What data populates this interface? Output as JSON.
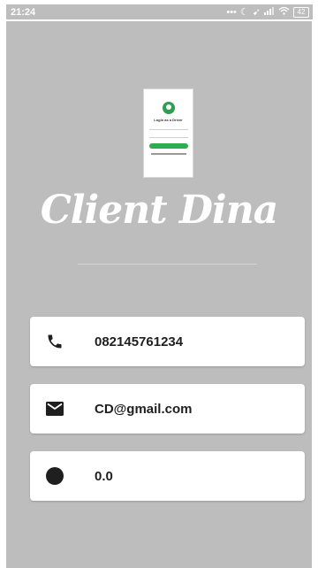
{
  "status_bar": {
    "time": "21:24",
    "icons": [
      "more-dots-icon",
      "moon-icon",
      "location-arrow-icon",
      "signal-icon",
      "wifi-icon"
    ],
    "battery": "42"
  },
  "login_preview": {
    "title": "Login as a Driver",
    "logo_icon": "map-pin-icon"
  },
  "brand": {
    "name": "Client Dina"
  },
  "profile": {
    "phone": {
      "icon": "phone-icon",
      "value": "082145761234"
    },
    "email": {
      "icon": "mail-icon",
      "value": "CD@gmail.com"
    },
    "rating": {
      "icon": "circle-icon",
      "value": "0.0"
    }
  },
  "colors": {
    "background": "#bdbdbd",
    "card": "#ffffff",
    "accent_green": "#2fae4e",
    "text": "#1f1f1f"
  }
}
